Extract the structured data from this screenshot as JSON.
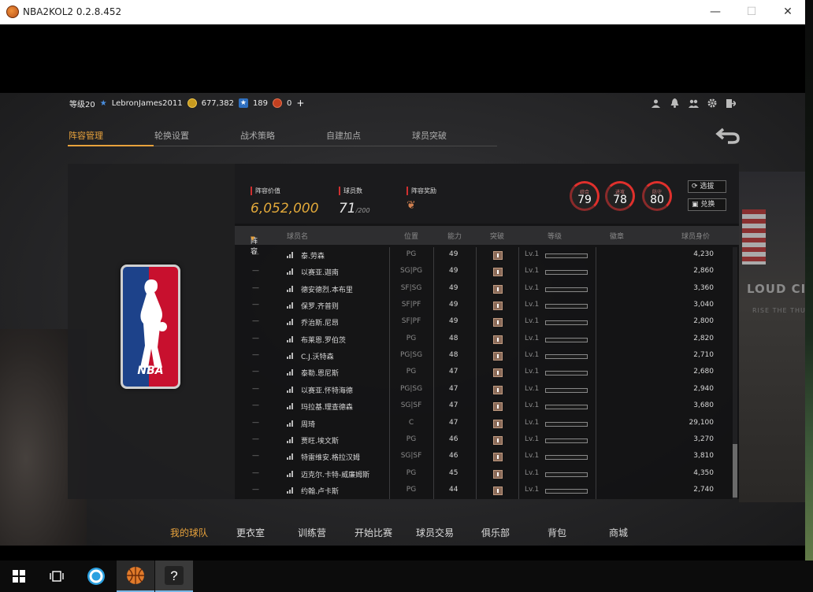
{
  "window": {
    "title": "NBA2KOL2 0.2.8.452",
    "minimize": "—",
    "maximize": "☐",
    "close": "✕"
  },
  "topbar": {
    "level": "等级20",
    "username": "LebronJames2011",
    "coins": "677,382",
    "stars": "189",
    "dcoins": "0",
    "plus": "+"
  },
  "tabs": [
    {
      "label": "阵容管理",
      "active": true
    },
    {
      "label": "轮换设置"
    },
    {
      "label": "战术策略"
    },
    {
      "label": "自建加点"
    },
    {
      "label": "球员突破"
    }
  ],
  "summary": {
    "value_label": "阵容价值",
    "value": "6,052,000",
    "count_label": "球员数",
    "count": "71",
    "count_max": "/200",
    "reward_label": "阵容奖励"
  },
  "ratings": [
    {
      "label": "综合",
      "value": "79"
    },
    {
      "label": "进攻",
      "value": "78"
    },
    {
      "label": "防守",
      "value": "80"
    }
  ],
  "buttons": {
    "select": "选拔",
    "exchange": "兑换"
  },
  "table": {
    "headers": [
      "阵容",
      "球员名",
      "位置",
      "能力",
      "突破",
      "等级",
      "徽章",
      "球员身价"
    ],
    "rows": [
      {
        "lineup": "—",
        "name": "泰.劳森",
        "pos": "PG",
        "ovr": "49",
        "lv": "Lv.1",
        "price": "4,230"
      },
      {
        "lineup": "—",
        "name": "以赛亚.迦南",
        "pos": "SG|PG",
        "ovr": "49",
        "lv": "Lv.1",
        "price": "2,860"
      },
      {
        "lineup": "—",
        "name": "德安德烈.本布里",
        "pos": "SF|SG",
        "ovr": "49",
        "lv": "Lv.1",
        "price": "3,360"
      },
      {
        "lineup": "—",
        "name": "保罗.齐普则",
        "pos": "SF|PF",
        "ovr": "49",
        "lv": "Lv.1",
        "price": "3,040"
      },
      {
        "lineup": "—",
        "name": "乔治斯.尼昂",
        "pos": "SF|PF",
        "ovr": "49",
        "lv": "Lv.1",
        "price": "2,800"
      },
      {
        "lineup": "—",
        "name": "布莱恩.罗伯茨",
        "pos": "PG",
        "ovr": "48",
        "lv": "Lv.1",
        "price": "2,820"
      },
      {
        "lineup": "—",
        "name": "C.J.沃特森",
        "pos": "PG|SG",
        "ovr": "48",
        "lv": "Lv.1",
        "price": "2,710"
      },
      {
        "lineup": "—",
        "name": "泰勒.恩尼斯",
        "pos": "PG",
        "ovr": "47",
        "lv": "Lv.1",
        "price": "2,680"
      },
      {
        "lineup": "—",
        "name": "以赛亚.怀特海德",
        "pos": "PG|SG",
        "ovr": "47",
        "lv": "Lv.1",
        "price": "2,940"
      },
      {
        "lineup": "—",
        "name": "玛拉基.理查德森",
        "pos": "SG|SF",
        "ovr": "47",
        "lv": "Lv.1",
        "price": "3,680"
      },
      {
        "lineup": "—",
        "name": "周琦",
        "pos": "C",
        "ovr": "47",
        "lv": "Lv.1",
        "price": "29,100"
      },
      {
        "lineup": "—",
        "name": "贾旺.埃文斯",
        "pos": "PG",
        "ovr": "46",
        "lv": "Lv.1",
        "price": "3,270"
      },
      {
        "lineup": "—",
        "name": "特雷维安.格拉汉姆",
        "pos": "SG|SF",
        "ovr": "46",
        "lv": "Lv.1",
        "price": "3,810"
      },
      {
        "lineup": "—",
        "name": "迈克尔.卡特-威廉姆斯",
        "pos": "PG",
        "ovr": "45",
        "lv": "Lv.1",
        "price": "4,350"
      },
      {
        "lineup": "—",
        "name": "约翰.卢卡斯",
        "pos": "PG",
        "ovr": "44",
        "lv": "Lv.1",
        "price": "2,740"
      }
    ]
  },
  "bottom_nav": [
    {
      "label": "我的球队",
      "active": true
    },
    {
      "label": "更衣室"
    },
    {
      "label": "训练营"
    },
    {
      "label": "开始比赛"
    },
    {
      "label": "球员交易"
    },
    {
      "label": "俱乐部"
    },
    {
      "label": "背包"
    },
    {
      "label": "商城"
    }
  ],
  "arena": {
    "sign": "LOUD CITY",
    "sign_sub": "RISE THE THUN"
  },
  "logo": {
    "text": "NBA"
  },
  "taskbar": {
    "help": "?"
  },
  "colors": {
    "accent": "#e8a23c",
    "ring": "#e0302c"
  }
}
